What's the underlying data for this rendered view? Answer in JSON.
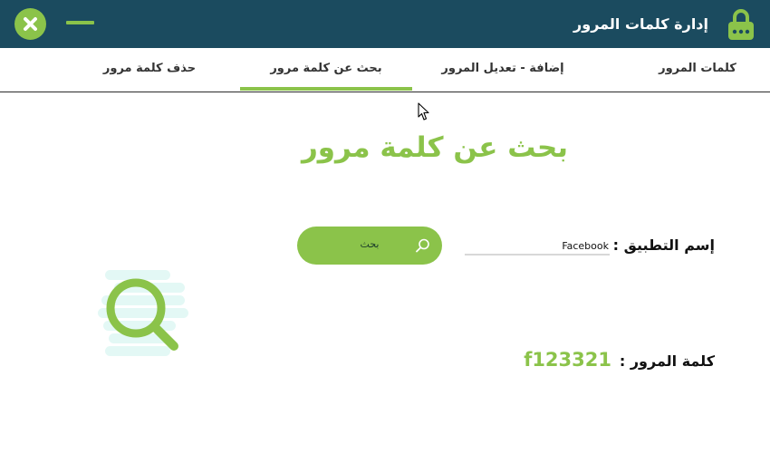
{
  "window": {
    "title": "إدارة كلمات المرور",
    "accent": "#8bc34a",
    "titlebar_color": "#1b4b5f"
  },
  "tabs": [
    {
      "label": "كلمات المرور",
      "active": false
    },
    {
      "label": "إضافة - تعديل المرور",
      "active": false
    },
    {
      "label": "بحث عن كلمة مرور",
      "active": true
    },
    {
      "label": "حذف كلمة مرور",
      "active": false
    }
  ],
  "main": {
    "heading": "بحث عن كلمة مرور",
    "app_name_label": "إسم التطبيق :",
    "app_name_value": "Facebook",
    "search_button_label": "بحث",
    "password_label": "كلمة المرور :",
    "password_value": "f123321"
  },
  "icons": {
    "titlebar_left": "close-icon",
    "titlebar_min": "minimize-icon",
    "titlebar_right": "lock-icon",
    "search_button": "search-icon",
    "illustration": "magnifier-illustration-icon",
    "pointer": "mouse-cursor-icon"
  }
}
